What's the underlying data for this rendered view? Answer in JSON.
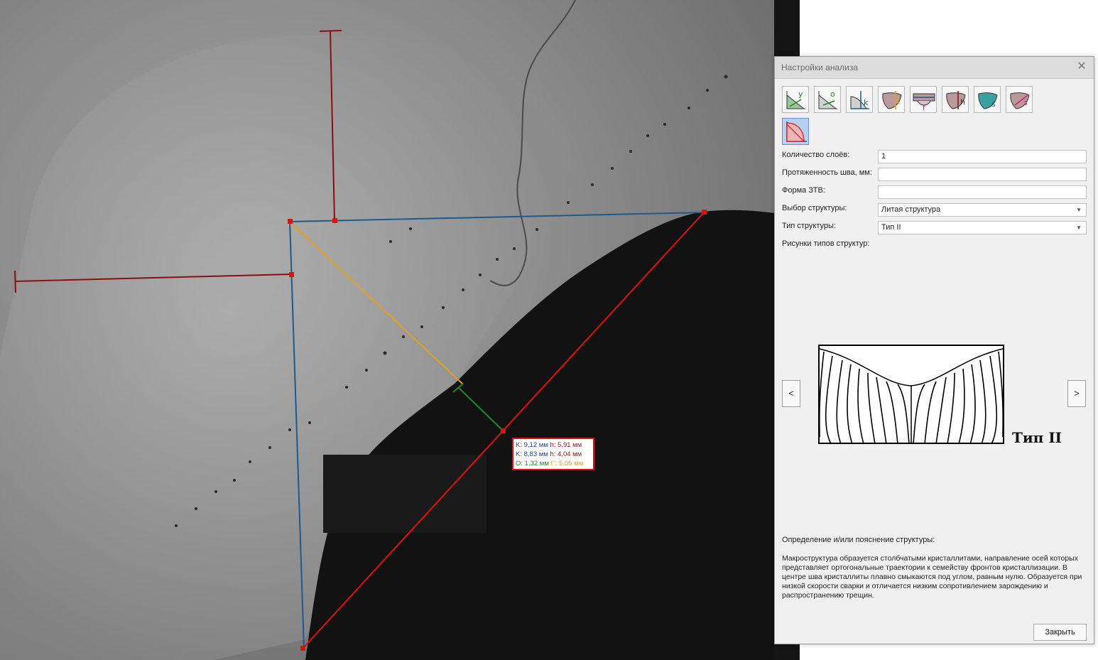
{
  "measurement": {
    "k1": "K: 9,12 мм",
    "h1": "h: 5,91 мм",
    "k2": "K: 8,83 мм",
    "h2": "h: 4,04 мм",
    "o": "O: 1,32 мм",
    "t": "t'': 5,05 мм"
  },
  "colors": {
    "outline_red": "#e01010",
    "leg_blue": "#1f5a8a",
    "dim_darkred": "#8a1010",
    "orange": "#e0a020",
    "green": "#1f8a1f"
  },
  "dialog": {
    "title": "Настройки анализа",
    "tools": [
      {
        "icon": "leg-y-icon",
        "letter": "y"
      },
      {
        "icon": "leg-o-icon",
        "letter": "o"
      },
      {
        "icon": "leg-k-icon",
        "letter": "k"
      },
      {
        "icon": "bead-t-icon",
        "letter": "t"
      },
      {
        "icon": "bead-f-icon",
        "letter": "f"
      },
      {
        "icon": "bead-h-icon",
        "letter": "h"
      },
      {
        "icon": "bead-s-icon",
        "letter": "s"
      },
      {
        "icon": "bead-z-icon",
        "letter": "з"
      },
      {
        "icon": "weld-zone-icon",
        "letter": ""
      }
    ],
    "fields": {
      "layers_label": "Количество слоёв:",
      "layers_value": "1",
      "length_label": "Протяженность шва, мм:",
      "length_value": "",
      "haz_label": "Форма ЗТВ:",
      "haz_value": "",
      "structure_label": "Выбор структуры:",
      "structure_value": "Литая структура",
      "type_label": "Тип структуры:",
      "type_value": "Тип II"
    },
    "pictures_label": "Рисунки типов структур:",
    "prev": "<",
    "next": ">",
    "structure_caption": "Тип II",
    "desc_label": "Определение и/или пояснение структуры:",
    "desc_text": "Макроструктура образуется столбчатыми кристаллитами, направление осей которых представляет ортогональные траектории к семейству фронтов кристаллизации. В центре шва кристаллиты плавно смыкаются под углом, равным нулю. Образуется при низкой скорости сварки и отличается низким сопротивлением зарождению и распространению трещин.",
    "close_button": "Закрыть"
  }
}
